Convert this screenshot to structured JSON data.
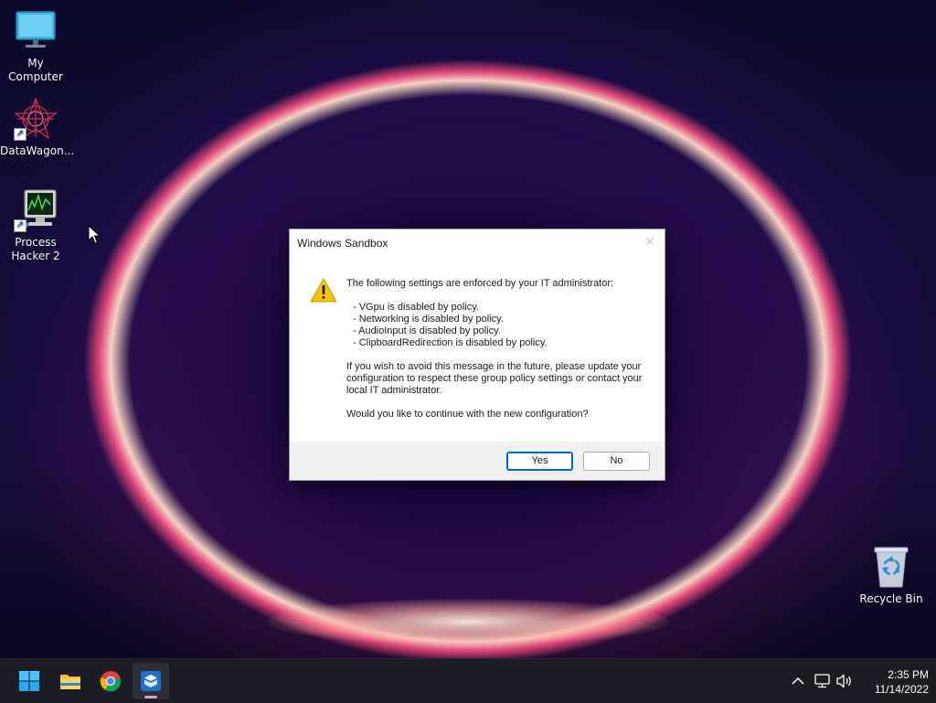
{
  "desktop_icons": [
    {
      "label": "My Computer",
      "icon": "monitor-icon"
    },
    {
      "label": "DataWagon...",
      "icon": "datawagon-icon"
    },
    {
      "label": "Process Hacker 2",
      "icon": "process-hacker-icon"
    },
    {
      "label": "Recycle Bin",
      "icon": "recycle-bin-icon"
    }
  ],
  "dialog": {
    "title": "Windows Sandbox",
    "intro": "The following settings are enforced by your IT administrator:",
    "policies": [
      "- VGpu is disabled by policy.",
      "- Networking is disabled by policy.",
      "- AudioInput is disabled by policy.",
      "- ClipboardRedirection is disabled by policy."
    ],
    "advice": "If you wish to avoid this message in the future, please update your configuration to respect these group policy settings or contact your local IT administrator.",
    "question": "Would you like to continue with the new configuration?",
    "yes_label": "Yes",
    "no_label": "No",
    "icon": "warning-icon"
  },
  "taskbar": {
    "apps": [
      {
        "name": "Start",
        "icon": "windows-start-icon"
      },
      {
        "name": "File Explorer",
        "icon": "folder-icon"
      },
      {
        "name": "Google Chrome",
        "icon": "chrome-icon"
      },
      {
        "name": "Windows Sandbox",
        "icon": "sandbox-icon",
        "active": true
      }
    ],
    "tray_icons": [
      "chevron-up-icon",
      "network-icon",
      "speaker-icon"
    ],
    "time": "2:35 PM",
    "date": "11/14/2022"
  },
  "colors": {
    "accent": "#0067c0",
    "taskbar_bg": "#1c1c24",
    "warning_yellow": "#f5c400"
  }
}
